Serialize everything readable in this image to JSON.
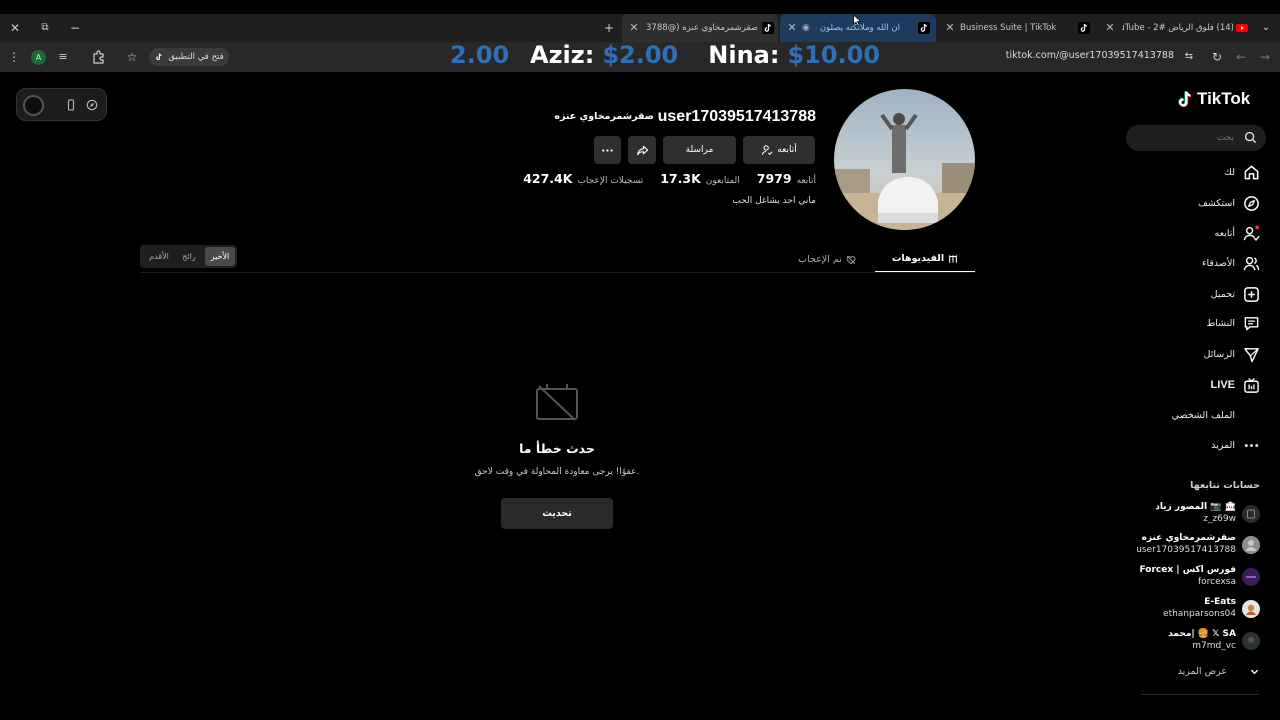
{
  "browser": {
    "tabs": [
      {
        "title": "(14) فلوق الرياض #2 - YouTube"
      },
      {
        "title": "Business Suite | TikTok"
      },
      {
        "title": "ان الله وملائكته يصلون على ا"
      },
      {
        "title": "صقرشمرمخاوي عنزه (@user17039517413788"
      }
    ],
    "address": "tiktok.com/@user17039517413788",
    "open_in_app": "فتح في التطبيق",
    "profile_initial": "A"
  },
  "overlay": {
    "left_value": "2.00",
    "name1": "Aziz:",
    "value1": "$2.00",
    "name2": "Nina:",
    "value2": "$10.00",
    "color_name": "#ffffff",
    "color_value": "#2f6fb5"
  },
  "brand": {
    "name": "TikTok"
  },
  "search": {
    "placeholder": "بحث"
  },
  "nav": [
    {
      "label": "لك",
      "icon": "home-icon"
    },
    {
      "label": "استكشف",
      "icon": "compass-icon"
    },
    {
      "label": "أتابعه",
      "icon": "following-icon"
    },
    {
      "label": "الأصدقاء",
      "icon": "friends-icon"
    },
    {
      "label": "تحميل",
      "icon": "upload-icon"
    },
    {
      "label": "النشاط",
      "icon": "activity-icon"
    },
    {
      "label": "الرسائل",
      "icon": "messages-icon"
    },
    {
      "label": "LIVE",
      "icon": "live-icon"
    },
    {
      "label": "الملف الشخصي",
      "icon": "profile-icon"
    },
    {
      "label": "المزيد",
      "icon": "more-icon"
    }
  ],
  "following_accounts": {
    "heading": "حسابات تتابعها",
    "items": [
      {
        "name": "المصور زياد 📷 🏛",
        "handle": "z_z69w"
      },
      {
        "name": "صقرشمرمخاوي عنزه",
        "handle": "user17039517413788"
      },
      {
        "name": "Forcex | فورس اكس",
        "handle": "forcexsa"
      },
      {
        "name": "E-Eats",
        "handle": "ethanparsons04"
      },
      {
        "name": "محمد| 🍔 𝕏 SA",
        "handle": "m7md_vc"
      }
    ],
    "see_more": "عرض المزيد"
  },
  "profile": {
    "username": "user17039517413788",
    "display_name": "صقرشمرمخاوي عنزه",
    "follow_label": "أتابعه",
    "message_label": "مراسلة",
    "following_count": "7979",
    "following_label": "أتابعه",
    "followers_count": "17.3K",
    "followers_label": "المتابعون",
    "likes_count": "427.4K",
    "likes_label": "تسجيلات الإعجاب",
    "bio": "ماني احد يشاغل الحب"
  },
  "tabs": {
    "videos": "الفيديوهات",
    "liked": "تم الإعجاب"
  },
  "sort": {
    "latest": "الأخير",
    "popular": "رائج",
    "oldest": "الأقدم"
  },
  "error": {
    "title": "حدث خطأ ما",
    "message": "عفوًا! يرجى معاودة المحاولة في وقت لاحق.",
    "button": "تحديث"
  }
}
